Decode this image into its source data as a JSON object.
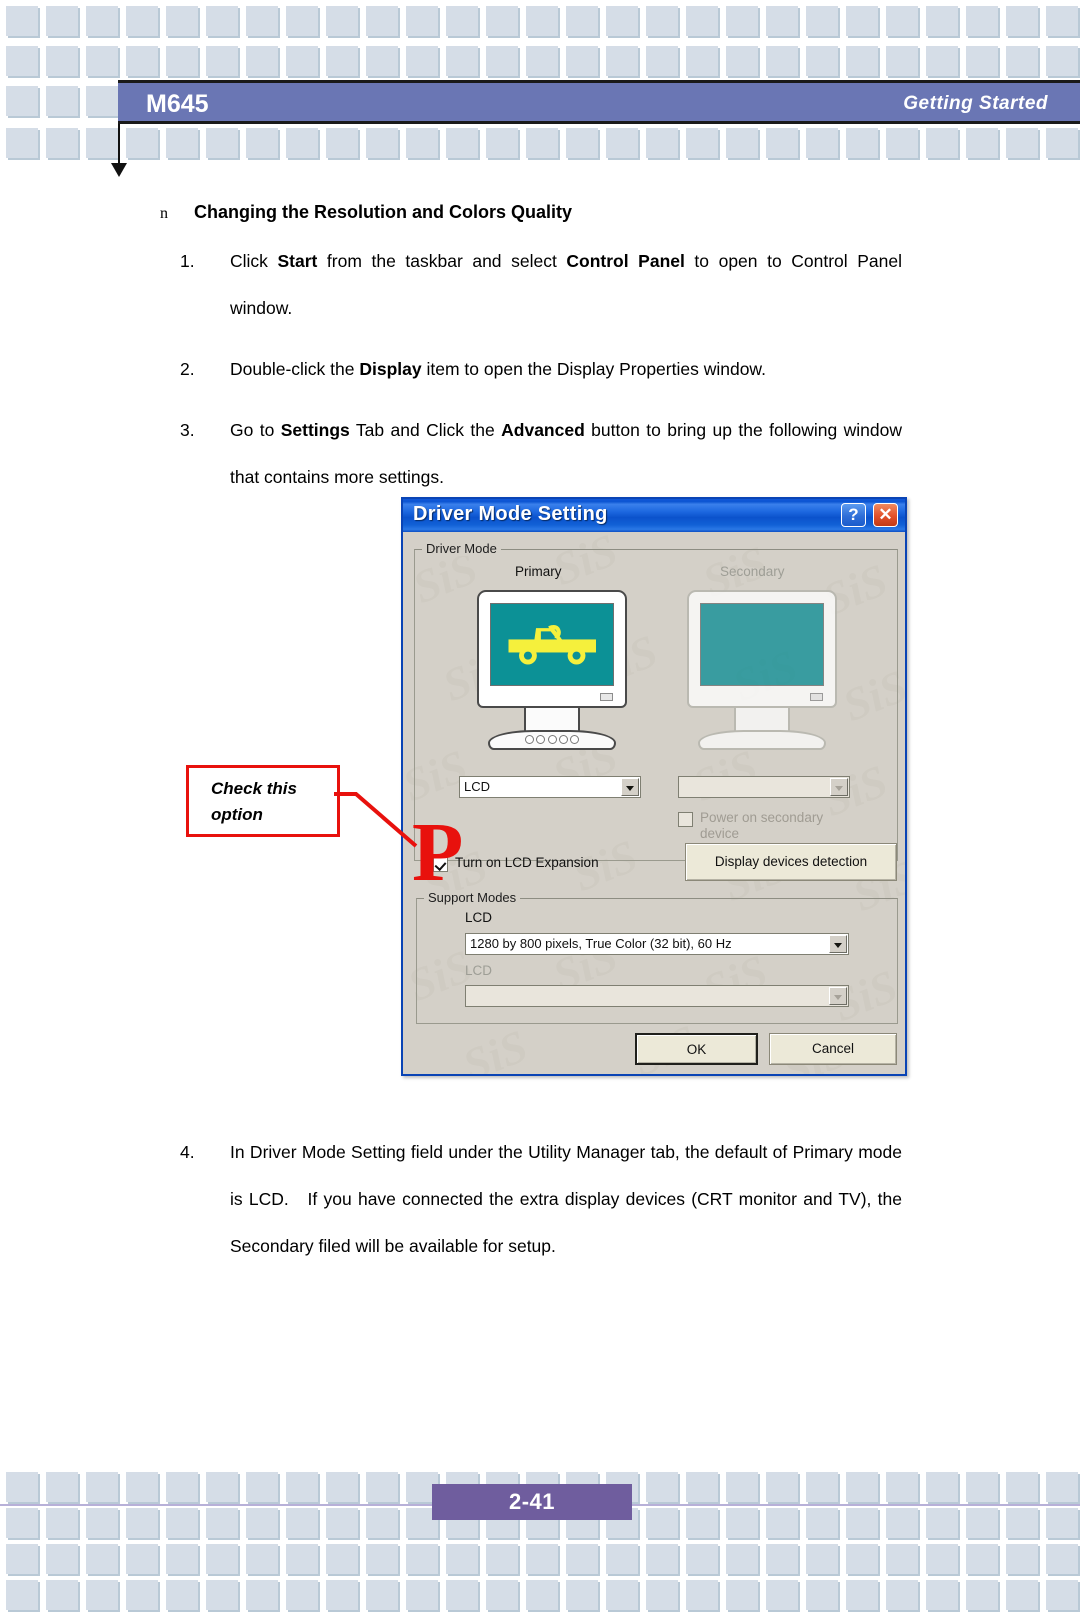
{
  "header": {
    "model": "M645",
    "section": "Getting  Started"
  },
  "content": {
    "heading": {
      "bullet": "n",
      "text": "Changing the Resolution and Colors Quality"
    },
    "steps": [
      {
        "num": "1.",
        "html": "Click <b>Start</b> from the taskbar and select <b>Control Panel</b> to open to Control Panel window."
      },
      {
        "num": "2.",
        "html": "Double-click the <b>Display</b> item to open the Display Properties window."
      },
      {
        "num": "3.",
        "html": "Go to <b>Settings</b> Tab and Click the <b>Advanced</b> button to bring up the following window that contains more settings."
      },
      {
        "num": "4.",
        "html": "In Driver Mode Setting field under the Utility Manager tab, the default of Primary mode is LCD.&nbsp;&nbsp; If you have connected the extra display devices (CRT monitor and TV), the Secondary filed will be available for setup."
      }
    ]
  },
  "callout": {
    "line1": "Check this",
    "line2": "option",
    "arrow_glyph": "P",
    "color": "#e8110d"
  },
  "dialog": {
    "title": "Driver Mode Setting",
    "help_button": "?",
    "close_button": "✕",
    "watermark_text": "SiS",
    "driver_mode_group": {
      "legend": "Driver Mode",
      "primary_label": "Primary",
      "secondary_label": "Secondary",
      "primary_combo_value": "LCD",
      "secondary_combo_value": "",
      "power_on_secondary_label": "Power on secondary device",
      "power_on_secondary_checked": false,
      "lcd_expansion_label": "Turn on LCD Expansion",
      "lcd_expansion_checked": true,
      "detect_button": "Display devices detection",
      "primary_screen_color": "#0c9196",
      "secondary_screen_color": "#0c9196",
      "jeep_color": "#f5f03c"
    },
    "support_modes_group": {
      "legend": "Support Modes",
      "lcd_label": "LCD",
      "lcd_mode_value": "1280 by 800 pixels, True Color (32 bit), 60 Hz",
      "lcd_label_2": "LCD",
      "lcd_mode_value_2": ""
    },
    "ok_button": "OK",
    "cancel_button": "Cancel"
  },
  "footer": {
    "page": "2-41"
  },
  "colors": {
    "header_bar": "#6a76b4",
    "page_badge": "#6f5d9e",
    "tile": "#d5dde7",
    "titlebar_blue": "#0d55d2"
  }
}
